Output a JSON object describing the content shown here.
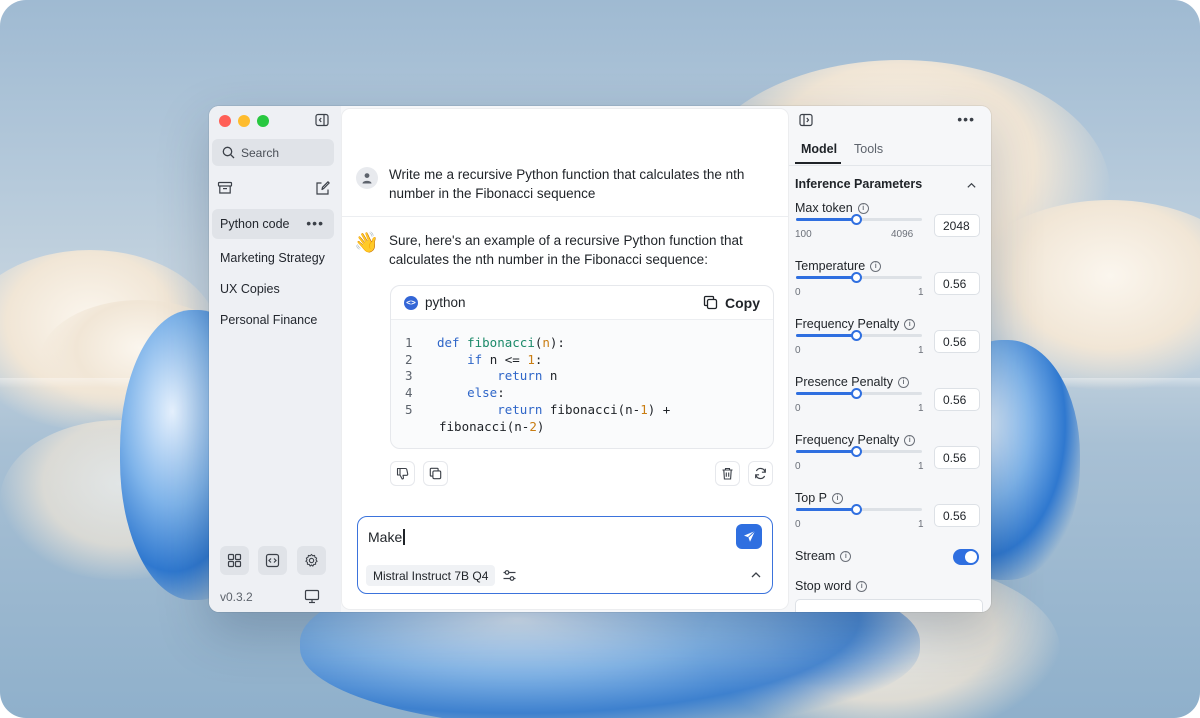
{
  "sidebar": {
    "search_label": "Search",
    "conversations": [
      {
        "label": "Python code"
      },
      {
        "label": "Marketing Strategy"
      },
      {
        "label": "UX Copies"
      },
      {
        "label": "Personal Finance"
      }
    ],
    "more_glyph": "•••",
    "version": "v0.3.2"
  },
  "chat": {
    "user_message": "Write me a recursive Python function that calculates the nth number in the Fibonacci sequence",
    "assistant_emoji": "👋",
    "assistant_message": "Sure, here's an example of a recursive Python function that calculates the nth number in the Fibonacci sequence:",
    "code": {
      "language": "python",
      "language_glyph": "<>",
      "copy_label": "Copy",
      "line_numbers": [
        "1",
        "2",
        "3",
        "4",
        "5"
      ],
      "lines": {
        "l1_kw": "def ",
        "l1_fn": "fibonacci",
        "l1_open": "(",
        "l1_param": "n",
        "l1_close": "):",
        "l2_indent": "    ",
        "l2_kw": "if",
        "l2_mid": " n <= ",
        "l2_num": "1",
        "l2_end": ":",
        "l3_indent": "        ",
        "l3_kw": "return",
        "l3_end": " n",
        "l4_indent": "    ",
        "l4_kw": "else",
        "l4_end": ":",
        "l5_indent": "        ",
        "l5_kw": "return",
        "l5_mid": " fibonacci(n-",
        "l5_num": "1",
        "l5_end": ") +",
        "l6_start": "fibonacci(n-",
        "l6_num": "2",
        "l6_end": ")"
      }
    },
    "composer": {
      "value": "Make",
      "model": "Mistral Instruct 7B Q4"
    }
  },
  "panel": {
    "tabs": [
      "Model",
      "Tools"
    ],
    "section_title": "Inference Parameters",
    "info_glyph": "i",
    "params": [
      {
        "label": "Max token",
        "min": "100",
        "max": "4096",
        "value": "2048",
        "fraction": 0.48
      },
      {
        "label": "Temperature",
        "min": "0",
        "max": "1",
        "value": "0.56",
        "fraction": 0.48
      },
      {
        "label": "Frequency Penalty",
        "min": "0",
        "max": "1",
        "value": "0.56",
        "fraction": 0.48
      },
      {
        "label": "Presence Penalty",
        "min": "0",
        "max": "1",
        "value": "0.56",
        "fraction": 0.48
      },
      {
        "label": "Frequency Penalty",
        "min": "0",
        "max": "1",
        "value": "0.56",
        "fraction": 0.48
      },
      {
        "label": "Top P",
        "min": "0",
        "max": "1",
        "value": "0.56",
        "fraction": 0.48
      }
    ],
    "stream_label": "Stream",
    "stream_on": true,
    "stop_word_label": "Stop word"
  },
  "colors": {
    "accent": "#2f6fe0",
    "keyword": "#2f66c8",
    "function": "#1c8a6a",
    "number": "#c97d12"
  }
}
